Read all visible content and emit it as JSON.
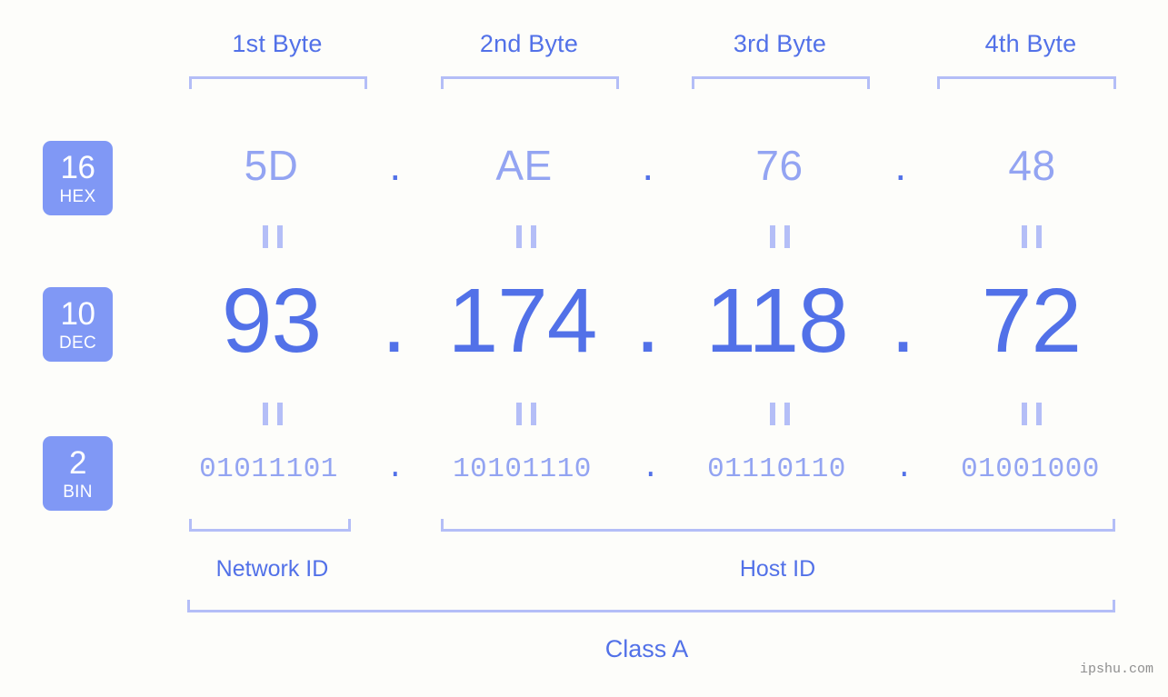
{
  "background_color": "#fdfdfa",
  "accent_color": "#5271e8",
  "light_accent_color": "#93a4f2",
  "bracket_color": "#b4bef7",
  "badge_color": "#8098f5",
  "byte_headers": [
    {
      "label": "1st Byte"
    },
    {
      "label": "2nd Byte"
    },
    {
      "label": "3rd Byte"
    },
    {
      "label": "4th Byte"
    }
  ],
  "bases": [
    {
      "number": "16",
      "abbr": "HEX"
    },
    {
      "number": "10",
      "abbr": "DEC"
    },
    {
      "number": "2",
      "abbr": "BIN"
    }
  ],
  "separator": ".",
  "equals_symbol": "=",
  "rows": {
    "hex": {
      "values": [
        "5D",
        "AE",
        "76",
        "48"
      ]
    },
    "dec": {
      "values": [
        "93",
        "174",
        "118",
        "72"
      ]
    },
    "bin": {
      "values": [
        "01011101",
        "10101110",
        "01110110",
        "01001000"
      ]
    }
  },
  "segments": {
    "network_id": "Network ID",
    "host_id": "Host ID"
  },
  "class_label": "Class A",
  "watermark": "ipshu.com",
  "chart_data": {
    "type": "table",
    "title": "IP address byte breakdown",
    "categories": [
      "1st Byte",
      "2nd Byte",
      "3rd Byte",
      "4th Byte"
    ],
    "series": [
      {
        "name": "HEX",
        "values": [
          "5D",
          "AE",
          "76",
          "48"
        ]
      },
      {
        "name": "DEC",
        "values": [
          "93",
          "174",
          "118",
          "72"
        ]
      },
      {
        "name": "BIN",
        "values": [
          "01011101",
          "10101110",
          "01110110",
          "01001000"
        ]
      }
    ],
    "annotations": [
      "Network ID",
      "Host ID",
      "Class A"
    ]
  }
}
